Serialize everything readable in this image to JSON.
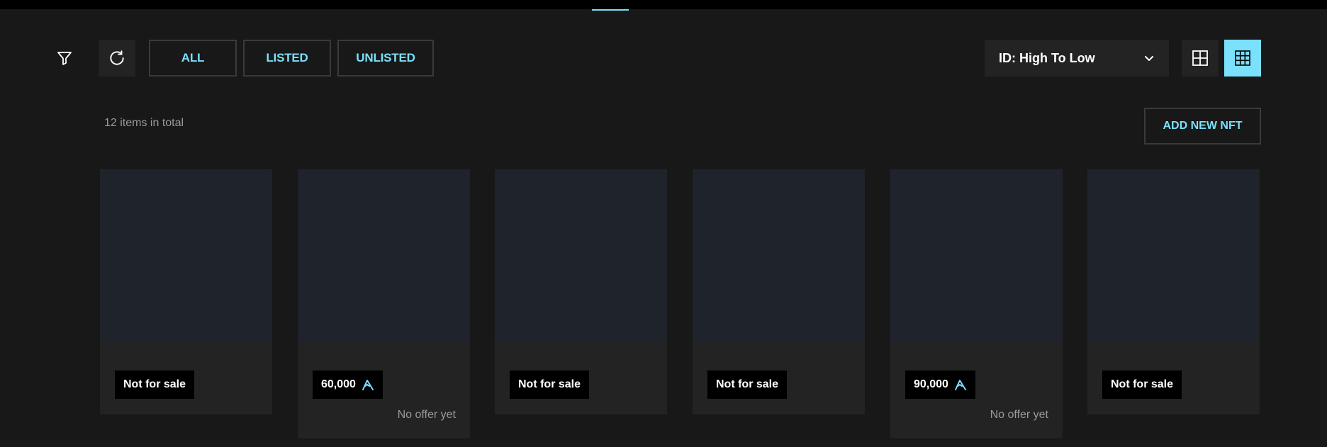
{
  "colors": {
    "accent": "#7ae0fb",
    "background": "#181818",
    "panel": "#232323",
    "thumb": "#1f232b"
  },
  "toolbar": {
    "filter_icon": "filter-icon",
    "refresh_icon": "refresh-icon",
    "tabs": [
      {
        "label": "ALL",
        "active": true
      },
      {
        "label": "LISTED",
        "active": false
      },
      {
        "label": "UNLISTED",
        "active": false
      }
    ],
    "sort": {
      "selected": "ID: High To Low",
      "icon": "chevron-down-icon"
    },
    "view_toggles": [
      {
        "icon": "grid-large-icon",
        "active": false
      },
      {
        "icon": "grid-small-icon",
        "active": true
      }
    ]
  },
  "summary": {
    "total_text": "12 items in total",
    "add_button": "ADD NEW NFT"
  },
  "cards": [
    {
      "price_text": "Not for sale",
      "has_currency": false,
      "offer_text": ""
    },
    {
      "price_text": "60,000",
      "has_currency": true,
      "offer_text": "No offer yet"
    },
    {
      "price_text": "Not for sale",
      "has_currency": false,
      "offer_text": ""
    },
    {
      "price_text": "Not for sale",
      "has_currency": false,
      "offer_text": ""
    },
    {
      "price_text": "90,000",
      "has_currency": true,
      "offer_text": "No offer yet"
    },
    {
      "price_text": "Not for sale",
      "has_currency": false,
      "offer_text": ""
    }
  ]
}
